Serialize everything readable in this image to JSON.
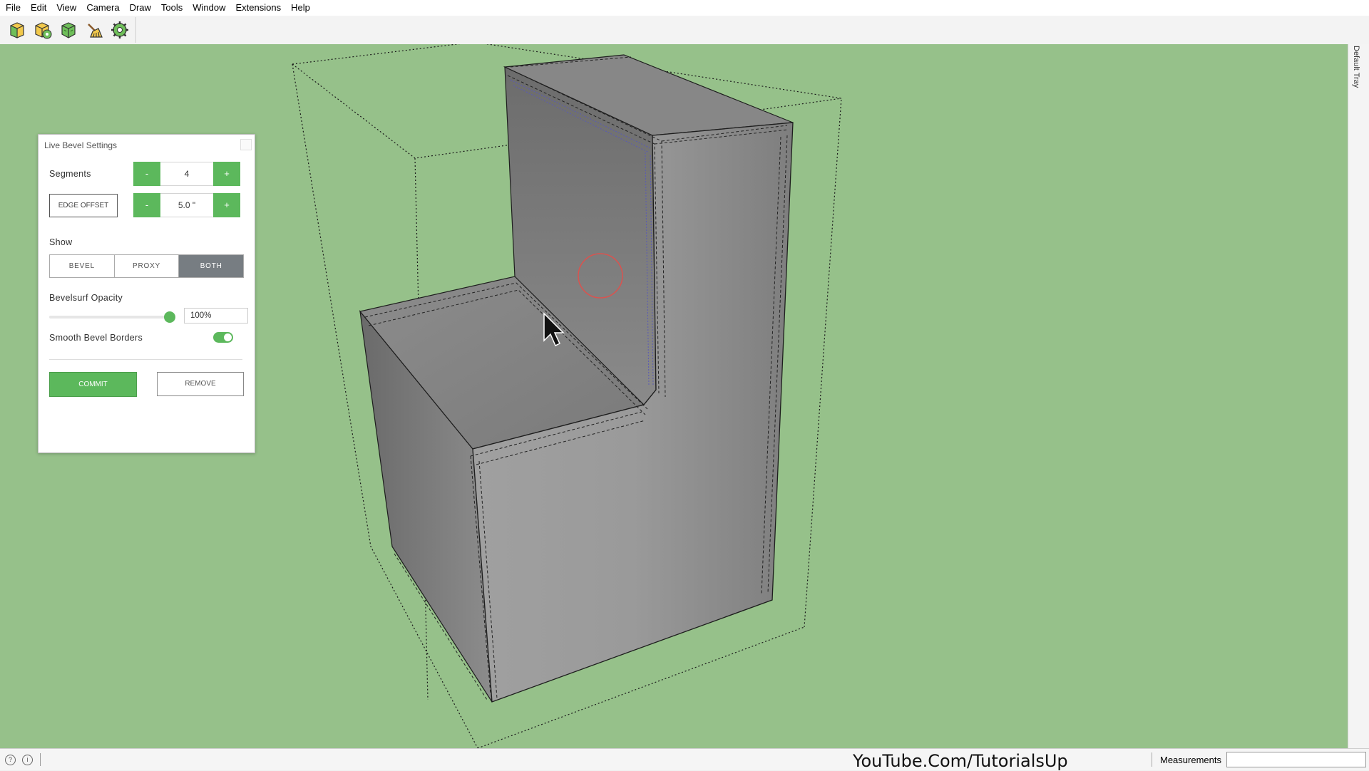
{
  "menubar": {
    "items": [
      "File",
      "Edit",
      "View",
      "Camera",
      "Draw",
      "Tools",
      "Window",
      "Extensions",
      "Help"
    ]
  },
  "toolbar": {
    "tools": [
      "live-bevel-icon",
      "bevel-settings-icon",
      "proxy-icon",
      "cleanup-broom-icon",
      "gear-settings-icon"
    ]
  },
  "tray": {
    "label": "Default Tray"
  },
  "dialog": {
    "title": "Live Bevel Settings",
    "segments_label": "Segments",
    "segments_value": "4",
    "minus": "-",
    "plus": "+",
    "edge_offset_label": "EDGE OFFSET",
    "edge_offset_value": "5.0 \"",
    "show_label": "Show",
    "show_options": [
      "BEVEL",
      "PROXY",
      "BOTH"
    ],
    "show_selected": "BOTH",
    "opacity_label": "Bevelsurf Opacity",
    "opacity_value": "100%",
    "opacity_level": 1.0,
    "smooth_label": "Smooth Bevel Borders",
    "smooth_on": true,
    "commit_label": "COMMIT",
    "remove_label": "REMOVE"
  },
  "statusbar": {
    "watermark": "YouTube.Com/TutorialsUp",
    "measurements_label": "Measurements",
    "measurements_value": ""
  },
  "colors": {
    "viewport_bg": "#96c18a",
    "accent_green": "#5cb85c",
    "active_segment": "#777d82",
    "inference_circle": "#d9534f"
  }
}
